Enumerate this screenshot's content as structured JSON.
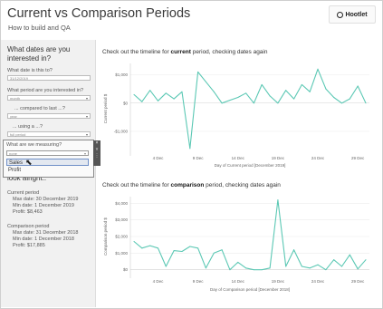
{
  "header": {
    "title": "Current vs Comparison Periods",
    "subtitle": "How to build and QA",
    "logo_text": "Hootlet"
  },
  "sidebar": {
    "heading": "What dates are you interested in?",
    "date_label": "What date is this to?",
    "date_value": "31/12/2019",
    "period_label": "What period are you interested in?",
    "period_value": "month",
    "compared_label": "... compared to last ...?",
    "compared_value": "year",
    "using_label": "... using a ...?",
    "using_value": "full period",
    "measure_label": "What are we measuring?",
    "measure_value": "none",
    "measure_options": [
      "Sales",
      "Profit"
    ],
    "look_heading": "look alright..",
    "current": {
      "heading": "Current period",
      "max": "Max date: 30 December 2019",
      "min": "Min date: 1 December 2019",
      "profit": "Profit: $8,463"
    },
    "comparison": {
      "heading": "Comparison period",
      "max": "Max date: 31 December 2018",
      "min": "Min date: 1 December 2018",
      "profit": "Profit: $17,885"
    }
  },
  "charts": {
    "current_title": [
      "Check out the timeline for ",
      "current",
      " period, checking dates again"
    ],
    "comparison_title": [
      "Check out the timeline for ",
      "comparison",
      " period, checking dates again"
    ]
  },
  "chart_data": [
    {
      "type": "line",
      "ylabel": "Current period $",
      "xlabel": "Day of Current period [December 2019]",
      "xticks": [
        "4 Dec",
        "9 Dec",
        "14 Dec",
        "19 Dec",
        "24 Dec",
        "29 Dec"
      ],
      "yticks": [
        "$1,000",
        "$0",
        "-$1,000"
      ],
      "ylim": [
        -1800,
        1400
      ],
      "color": "#5bc8b4",
      "x": [
        1,
        2,
        3,
        4,
        5,
        6,
        7,
        8,
        9,
        10,
        11,
        12,
        13,
        14,
        15,
        16,
        17,
        18,
        19,
        20,
        21,
        22,
        23,
        24,
        25,
        26,
        27,
        28,
        29,
        30
      ],
      "values": [
        300,
        50,
        450,
        80,
        350,
        150,
        400,
        -1600,
        1100,
        750,
        400,
        0,
        100,
        200,
        350,
        0,
        650,
        250,
        0,
        450,
        150,
        650,
        400,
        1200,
        500,
        200,
        0,
        150,
        600,
        0
      ]
    },
    {
      "type": "line",
      "ylabel": "Comparison period $",
      "xlabel": "Day of Comparison period [December 2018]",
      "xticks": [
        "4 Dec",
        "9 Dec",
        "14 Dec",
        "19 Dec",
        "24 Dec",
        "29 Dec"
      ],
      "yticks": [
        "$4,000",
        "$3,000",
        "$2,000",
        "$1,000",
        "$0"
      ],
      "ylim": [
        -400,
        4400
      ],
      "color": "#5bc8b4",
      "x": [
        1,
        2,
        3,
        4,
        5,
        6,
        7,
        8,
        9,
        10,
        11,
        12,
        13,
        14,
        15,
        16,
        17,
        18,
        19,
        20,
        21,
        22,
        23,
        24,
        25,
        26,
        27,
        28,
        29,
        30
      ],
      "values": [
        1700,
        1300,
        1450,
        1300,
        200,
        1150,
        1100,
        1400,
        1300,
        100,
        1000,
        1200,
        0,
        450,
        100,
        0,
        0,
        100,
        4200,
        200,
        1200,
        200,
        100,
        300,
        0,
        600,
        200,
        900,
        50,
        600
      ]
    }
  ]
}
